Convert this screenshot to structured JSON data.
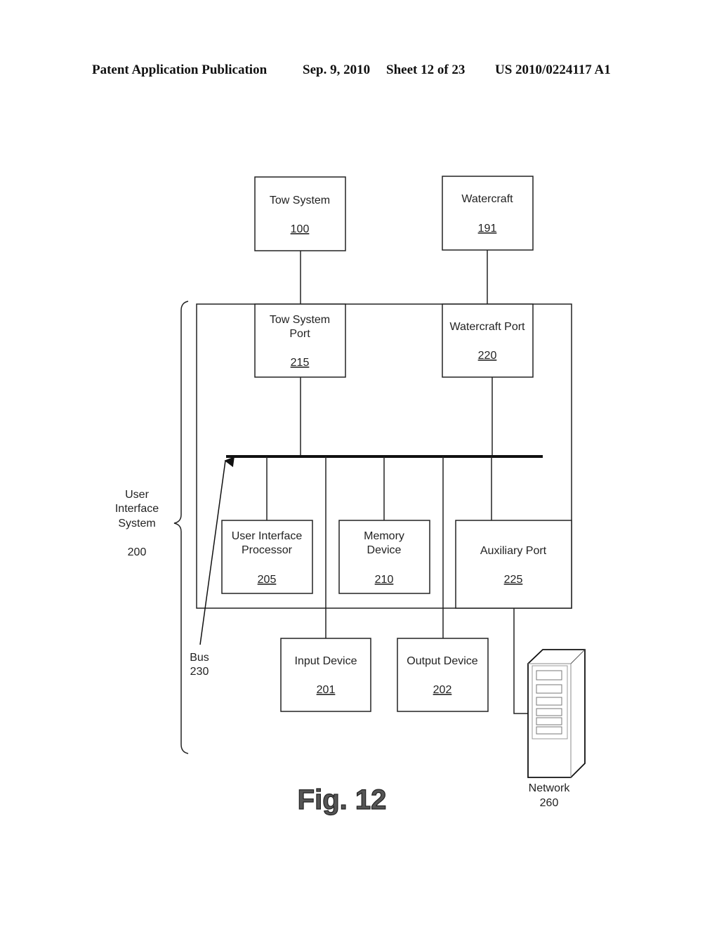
{
  "header": {
    "publication": "Patent Application Publication",
    "date": "Sep. 9, 2010",
    "sheet": "Sheet 12 of 23",
    "number": "US 2010/0224117 A1"
  },
  "figure": {
    "label": "Fig. 12",
    "system": {
      "lines": [
        "User",
        "Interface",
        "System"
      ],
      "ref": "200"
    },
    "bus": {
      "label": "Bus",
      "ref": "230"
    },
    "blocks": {
      "tow_system": {
        "lines": [
          "Tow System"
        ],
        "ref": "100"
      },
      "watercraft": {
        "lines": [
          "Watercraft"
        ],
        "ref": "191"
      },
      "tow_system_port": {
        "lines": [
          "Tow System",
          "Port"
        ],
        "ref": "215"
      },
      "watercraft_port": {
        "lines": [
          "Watercraft Port"
        ],
        "ref": "220"
      },
      "ui_processor": {
        "lines": [
          "User Interface",
          "Processor"
        ],
        "ref": "205"
      },
      "memory_device": {
        "lines": [
          "Memory",
          "Device"
        ],
        "ref": "210"
      },
      "auxiliary_port": {
        "lines": [
          "Auxiliary Port"
        ],
        "ref": "225"
      },
      "input_device": {
        "lines": [
          "Input Device"
        ],
        "ref": "201"
      },
      "output_device": {
        "lines": [
          "Output Device"
        ],
        "ref": "202"
      }
    },
    "network": {
      "label": "Network",
      "ref": "260",
      "icon": "server-tower-icon"
    }
  }
}
